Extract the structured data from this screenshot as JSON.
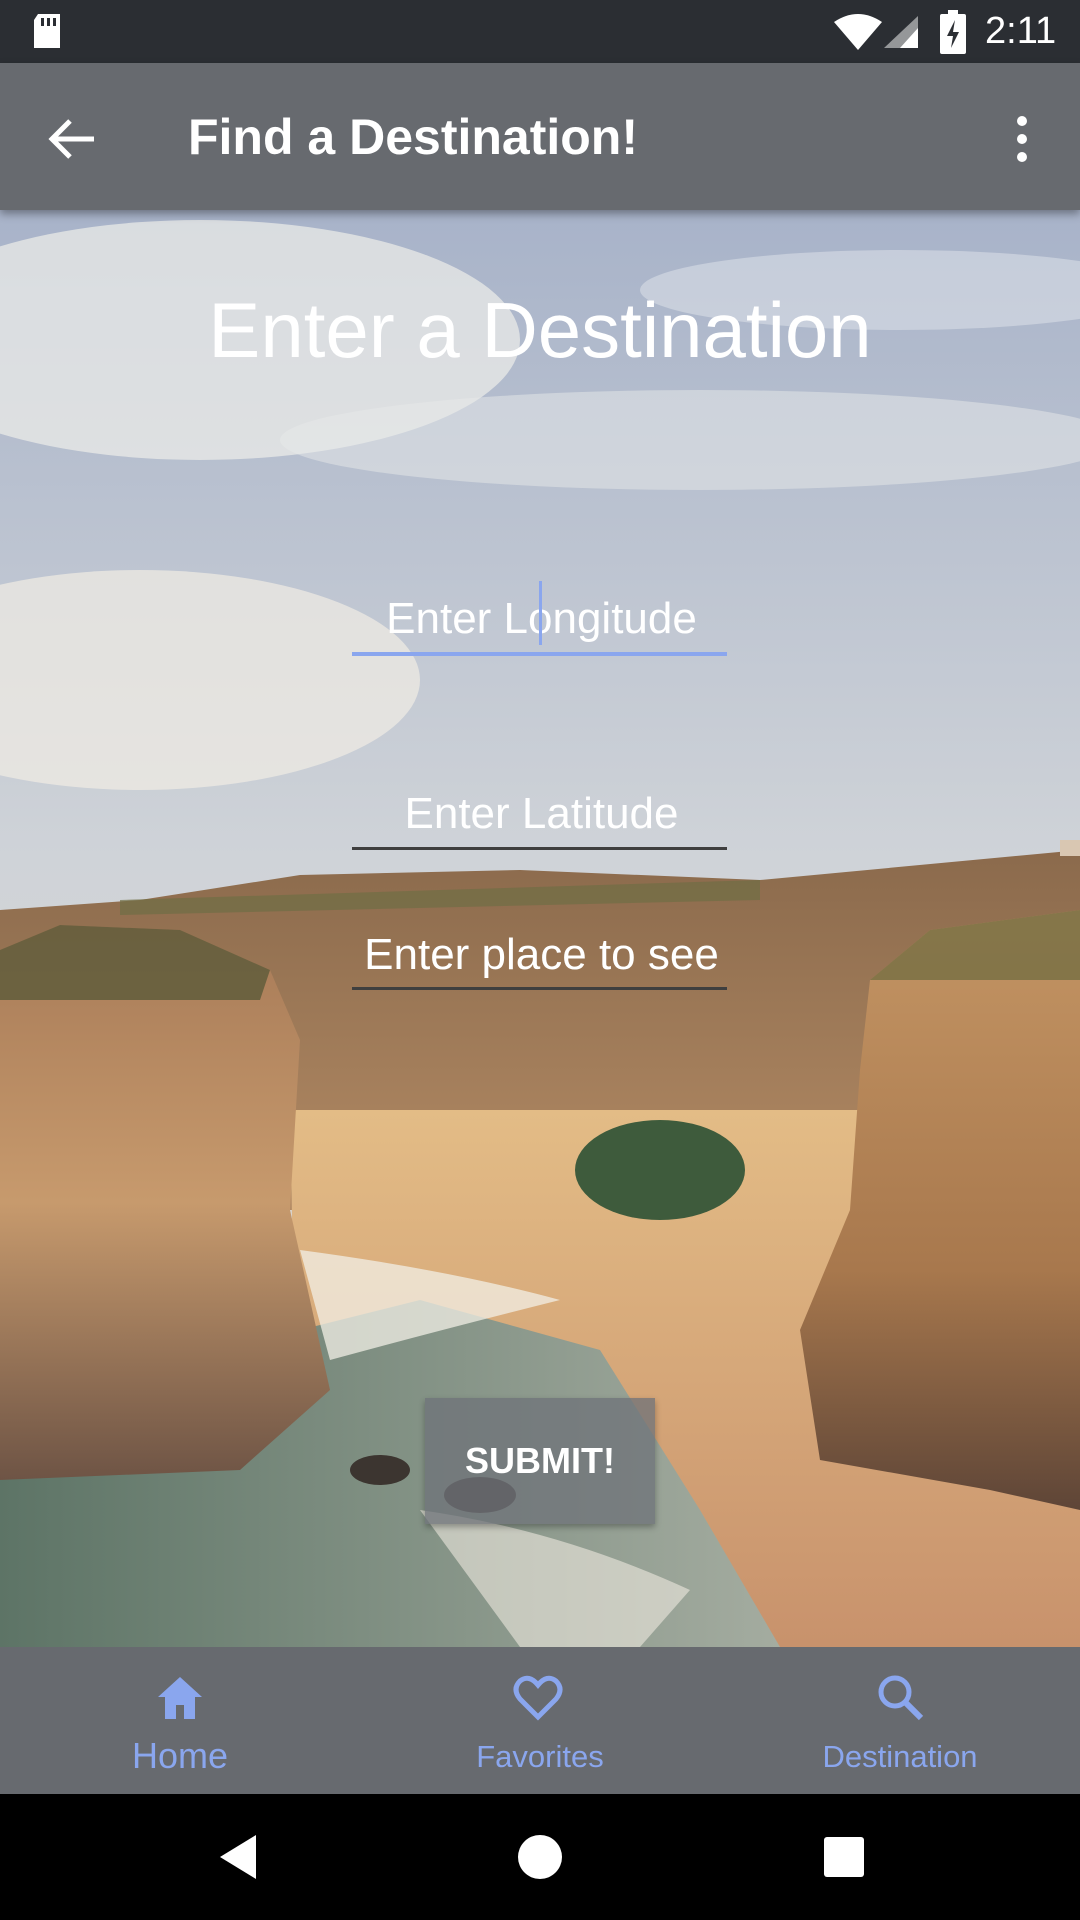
{
  "status_bar": {
    "time": "2:11",
    "icons": [
      "sd-card-icon",
      "wifi-icon",
      "signal-icon",
      "battery-charging-icon"
    ]
  },
  "app_bar": {
    "title": "Find a Destination!",
    "back_icon": "arrow-back-icon",
    "menu_icon": "more-vert-icon"
  },
  "main": {
    "heading": "Enter a Destination",
    "longitude_placeholder": "Enter Longitude",
    "latitude_placeholder": "Enter Latitude",
    "place_placeholder": "Enter place to see",
    "submit_label": "SUBMIT!"
  },
  "bottom_nav": {
    "items": [
      {
        "label": "Home",
        "icon": "home-icon",
        "active": true
      },
      {
        "label": "Favorites",
        "icon": "heart-outline-icon",
        "active": false
      },
      {
        "label": "Destination",
        "icon": "search-icon",
        "active": false
      }
    ]
  },
  "colors": {
    "accent": "#8aa6ee",
    "app_bar": "#676a6f",
    "status_bar": "#2b2e33"
  },
  "system_nav": {
    "icons": [
      "back-triangle-icon",
      "home-circle-icon",
      "recents-square-icon"
    ]
  }
}
